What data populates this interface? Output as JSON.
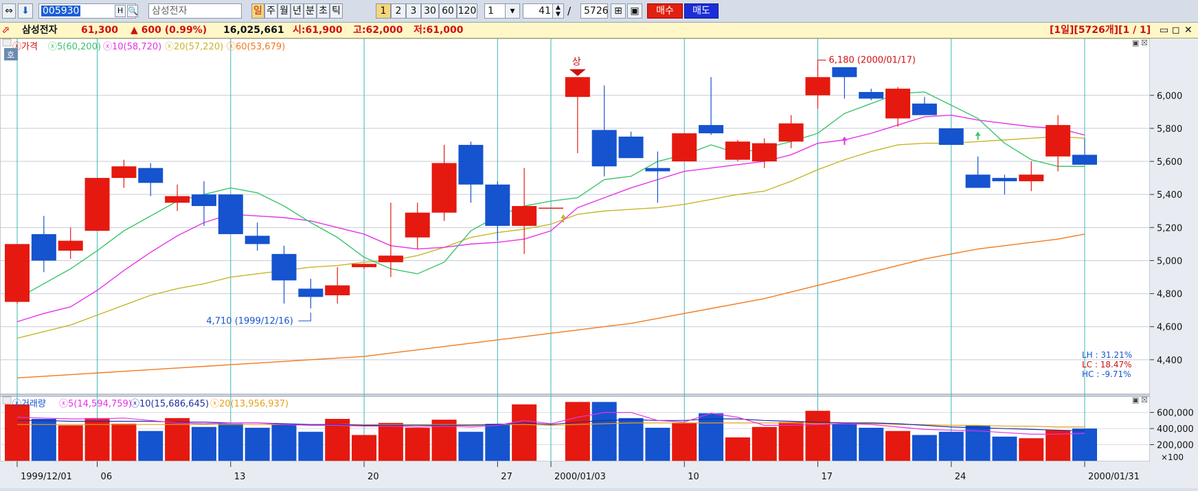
{
  "toolbar": {
    "code": "005930",
    "h_label": "H",
    "name": "삼성전자",
    "periods": [
      "일",
      "주",
      "월",
      "년",
      "분",
      "초",
      "틱"
    ],
    "minutes": [
      "1",
      "2",
      "3",
      "30",
      "60",
      "120"
    ],
    "select_value": "1",
    "count_value": "41",
    "slash": "/",
    "total": "5726",
    "buy_label": "매수",
    "sell_label": "매도"
  },
  "infobar": {
    "name": "삼성전자",
    "price": "61,300",
    "change": "▲ 600 (0.99%)",
    "volume": "16,025,661",
    "open": "시:61,900",
    "high": "고:62,000",
    "low": "저:61,000",
    "right_status": "[1일][5726개][1 / 1]"
  },
  "price_legend": {
    "label": "가격",
    "ma5": "5(60,200)",
    "ma10": "10(58,720)",
    "ma20": "20(57,220)",
    "ma60": "60(53,679)",
    "badge": "호"
  },
  "volume_legend": {
    "label": "거래량",
    "ma5": "5(14,594,759)",
    "ma10": "10(15,686,645)",
    "ma20": "20(13,956,937)"
  },
  "annotations": {
    "low_label": "4,710 (1999/12/16)",
    "high_label": "6,180 (2000/01/17)",
    "limit_up": "상",
    "lh": "LH : 31.21%",
    "lc": "LC : 18.47%",
    "hc": "HC : -9.71%"
  },
  "colors": {
    "up": "#e5190f",
    "down": "#1553cf",
    "ma5": "#3cc46c",
    "ma10": "#e533e5",
    "ma20": "#c8b52a",
    "ma60": "#f07a1e",
    "vline": "#3cb8b0"
  },
  "chart_data": {
    "type": "candlestick",
    "price_ylim": [
      4200,
      6240
    ],
    "price_ticks": [
      "6,000",
      "5,800",
      "5,600",
      "5,400",
      "5,200",
      "5,000",
      "4,800",
      "4,600",
      "4,400"
    ],
    "volume_ticks": [
      "600,000",
      "400,000",
      "200,000"
    ],
    "volume_unit": "×100",
    "volume_ylim": [
      0,
      750000
    ],
    "x_labels": [
      {
        "index": 0,
        "label": "1999/12/01"
      },
      {
        "index": 3,
        "label": "06"
      },
      {
        "index": 8,
        "label": "13"
      },
      {
        "index": 13,
        "label": "20"
      },
      {
        "index": 18,
        "label": "27"
      },
      {
        "index": 20,
        "label": "2000/01/03"
      },
      {
        "index": 25,
        "label": "10"
      },
      {
        "index": 30,
        "label": "17"
      },
      {
        "index": 35,
        "label": "24"
      },
      {
        "index": 40,
        "label": "2000/01/31"
      }
    ],
    "candles": [
      {
        "o": 4750,
        "h": 5100,
        "l": 4740,
        "c": 5100
      },
      {
        "o": 5160,
        "h": 5270,
        "l": 4930,
        "c": 5000
      },
      {
        "o": 5060,
        "h": 5200,
        "l": 5010,
        "c": 5120
      },
      {
        "o": 5180,
        "h": 5500,
        "l": 5180,
        "c": 5500
      },
      {
        "o": 5500,
        "h": 5610,
        "l": 5440,
        "c": 5570
      },
      {
        "o": 5560,
        "h": 5590,
        "l": 5390,
        "c": 5470
      },
      {
        "o": 5350,
        "h": 5460,
        "l": 5300,
        "c": 5390
      },
      {
        "o": 5400,
        "h": 5480,
        "l": 5210,
        "c": 5330
      },
      {
        "o": 5400,
        "h": 5400,
        "l": 5160,
        "c": 5160
      },
      {
        "o": 5150,
        "h": 5230,
        "l": 5060,
        "c": 5100
      },
      {
        "o": 5040,
        "h": 5090,
        "l": 4740,
        "c": 4880
      },
      {
        "o": 4830,
        "h": 4890,
        "l": 4710,
        "c": 4780
      },
      {
        "o": 4790,
        "h": 4960,
        "l": 4740,
        "c": 4850
      },
      {
        "o": 4960,
        "h": 4970,
        "l": 4950,
        "c": 4980
      },
      {
        "o": 4990,
        "h": 5350,
        "l": 4900,
        "c": 5030
      },
      {
        "o": 5140,
        "h": 5350,
        "l": 5070,
        "c": 5290
      },
      {
        "o": 5290,
        "h": 5700,
        "l": 5240,
        "c": 5590
      },
      {
        "o": 5700,
        "h": 5720,
        "l": 5350,
        "c": 5460
      },
      {
        "o": 5460,
        "h": 5480,
        "l": 5120,
        "c": 5210
      },
      {
        "o": 5210,
        "h": 5560,
        "l": 5040,
        "c": 5330
      },
      {
        "o": 5320,
        "h": 5320,
        "l": 5320,
        "c": 5320
      },
      {
        "o": 5990,
        "h": 6100,
        "l": 5650,
        "c": 6110
      },
      {
        "o": 5790,
        "h": 6060,
        "l": 5510,
        "c": 5570
      },
      {
        "o": 5750,
        "h": 5780,
        "l": 5620,
        "c": 5620
      },
      {
        "o": 5560,
        "h": 5660,
        "l": 5350,
        "c": 5540
      },
      {
        "o": 5600,
        "h": 5770,
        "l": 5600,
        "c": 5770
      },
      {
        "o": 5820,
        "h": 6110,
        "l": 5760,
        "c": 5770
      },
      {
        "o": 5610,
        "h": 5730,
        "l": 5600,
        "c": 5720
      },
      {
        "o": 5600,
        "h": 5740,
        "l": 5560,
        "c": 5710
      },
      {
        "o": 5720,
        "h": 5880,
        "l": 5680,
        "c": 5830
      },
      {
        "o": 6000,
        "h": 6180,
        "l": 5920,
        "c": 6110
      },
      {
        "o": 6170,
        "h": 6170,
        "l": 5980,
        "c": 6110
      },
      {
        "o": 6020,
        "h": 6040,
        "l": 5970,
        "c": 5980
      },
      {
        "o": 5860,
        "h": 6050,
        "l": 5810,
        "c": 6040
      },
      {
        "o": 5950,
        "h": 5990,
        "l": 5890,
        "c": 5880
      },
      {
        "o": 5800,
        "h": 5800,
        "l": 5700,
        "c": 5700
      },
      {
        "o": 5520,
        "h": 5630,
        "l": 5440,
        "c": 5440
      },
      {
        "o": 5500,
        "h": 5520,
        "l": 5400,
        "c": 5480
      },
      {
        "o": 5480,
        "h": 5600,
        "l": 5420,
        "c": 5520
      },
      {
        "o": 5630,
        "h": 5880,
        "l": 5540,
        "c": 5820
      },
      {
        "o": 5640,
        "h": 5740,
        "l": 5580,
        "c": 5580
      }
    ],
    "ma5": [
      4770,
      4860,
      4950,
      5060,
      5180,
      5270,
      5360,
      5400,
      5440,
      5410,
      5330,
      5230,
      5140,
      5020,
      4950,
      4920,
      4990,
      5180,
      5270,
      5330,
      5360,
      5380,
      5490,
      5510,
      5600,
      5640,
      5700,
      5650,
      5680,
      5720,
      5770,
      5890,
      5950,
      6010,
      6020,
      5940,
      5860,
      5710,
      5610,
      5570,
      5570
    ],
    "ma10": [
      4630,
      4680,
      4720,
      4820,
      4940,
      5050,
      5150,
      5230,
      5280,
      5270,
      5260,
      5240,
      5200,
      5160,
      5090,
      5070,
      5080,
      5100,
      5110,
      5130,
      5180,
      5320,
      5380,
      5440,
      5490,
      5540,
      5560,
      5580,
      5600,
      5640,
      5710,
      5730,
      5770,
      5820,
      5870,
      5880,
      5850,
      5830,
      5810,
      5800,
      5760
    ],
    "ma20": [
      4530,
      4570,
      4610,
      4670,
      4730,
      4790,
      4830,
      4860,
      4900,
      4920,
      4940,
      4960,
      4970,
      4990,
      5000,
      5030,
      5080,
      5140,
      5170,
      5190,
      5220,
      5280,
      5300,
      5310,
      5320,
      5340,
      5370,
      5400,
      5420,
      5480,
      5550,
      5610,
      5660,
      5700,
      5710,
      5710,
      5720,
      5730,
      5740,
      5750,
      5740
    ],
    "ma60": [
      4290,
      4300,
      4310,
      4320,
      4330,
      4340,
      4350,
      4360,
      4370,
      4380,
      4390,
      4400,
      4410,
      4420,
      4440,
      4460,
      4480,
      4500,
      4520,
      4540,
      4560,
      4580,
      4600,
      4620,
      4650,
      4680,
      4710,
      4740,
      4770,
      4810,
      4850,
      4890,
      4930,
      4970,
      5010,
      5040,
      5070,
      5090,
      5110,
      5130,
      5160
    ],
    "volumes": [
      700000,
      520000,
      440000,
      530000,
      460000,
      370000,
      530000,
      420000,
      460000,
      410000,
      450000,
      360000,
      520000,
      320000,
      470000,
      410000,
      510000,
      360000,
      460000,
      700000,
      0,
      730000,
      730000,
      530000,
      410000,
      470000,
      590000,
      290000,
      420000,
      480000,
      620000,
      460000,
      410000,
      370000,
      320000,
      360000,
      440000,
      300000,
      280000,
      380000,
      400000
    ],
    "vol_ma5": [
      540000,
      530000,
      520000,
      520000,
      530000,
      500000,
      470000,
      460000,
      470000,
      470000,
      450000,
      440000,
      440000,
      430000,
      430000,
      420000,
      430000,
      420000,
      440000,
      500000,
      460000,
      540000,
      600000,
      600000,
      500000,
      480000,
      590000,
      540000,
      440000,
      440000,
      450000,
      460000,
      450000,
      420000,
      390000,
      380000,
      370000,
      350000,
      330000,
      330000,
      340000
    ],
    "vol_ma10": [
      500000,
      500000,
      490000,
      490000,
      490000,
      490000,
      480000,
      480000,
      470000,
      470000,
      460000,
      450000,
      450000,
      440000,
      440000,
      440000,
      440000,
      440000,
      450000,
      470000,
      450000,
      480000,
      500000,
      510000,
      500000,
      500000,
      520000,
      520000,
      500000,
      490000,
      480000,
      470000,
      470000,
      460000,
      440000,
      420000,
      410000,
      400000,
      390000,
      380000,
      370000
    ],
    "vol_ma20": [
      450000,
      450000,
      450000,
      450000,
      450000,
      450000,
      450000,
      450000,
      450000,
      450000,
      450000,
      450000,
      450000,
      450000,
      450000,
      450000,
      450000,
      450000,
      450000,
      450000,
      440000,
      450000,
      460000,
      470000,
      470000,
      470000,
      470000,
      470000,
      470000,
      470000,
      460000,
      460000,
      460000,
      450000,
      450000,
      440000,
      440000,
      430000,
      430000,
      420000,
      420000
    ],
    "low_index": 11,
    "high_index": 30,
    "limit_up_index": 21
  }
}
